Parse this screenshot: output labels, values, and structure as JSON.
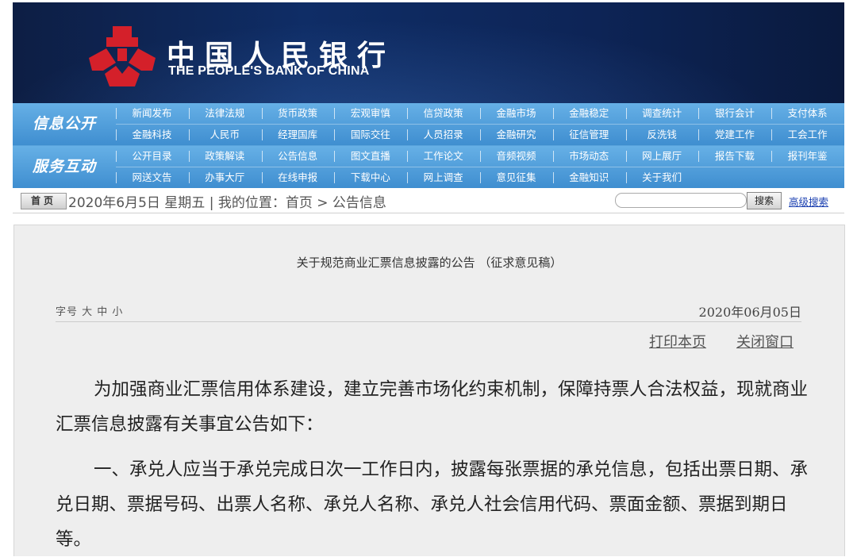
{
  "colors": {
    "banner_bg": "#0f2d66",
    "logo_red": "#d4202a",
    "nav_blue": "#4e9ad8",
    "link_blue": "#1a3fb0"
  },
  "header": {
    "logo_icon": "pboc-emblem-icon",
    "title_cn": "中国人民银行",
    "title_en": "THE PEOPLE'S BANK OF CHINA"
  },
  "nav": {
    "group1": {
      "label": "信息公开",
      "row1": [
        "新闻发布",
        "法律法规",
        "货币政策",
        "宏观审慎",
        "信贷政策",
        "金融市场",
        "金融稳定",
        "调查统计",
        "银行会计",
        "支付体系"
      ],
      "row2": [
        "金融科技",
        "人民币",
        "经理国库",
        "国际交往",
        "人员招录",
        "金融研究",
        "征信管理",
        "反洗钱",
        "党建工作",
        "工会工作"
      ]
    },
    "group2": {
      "label": "服务互动",
      "row1": [
        "公开目录",
        "政策解读",
        "公告信息",
        "图文直播",
        "工作论文",
        "音频视频",
        "市场动态",
        "网上展厅",
        "报告下载",
        "报刊年鉴"
      ],
      "row2": [
        "网送文告",
        "办事大厅",
        "在线申报",
        "下载中心",
        "网上调查",
        "意见征集",
        "金融知识",
        "关于我们"
      ]
    }
  },
  "breadcrumb": {
    "home_label": "首页",
    "text": "2020年6月5日 星期五 | 我的位置：首页 > 公告信息",
    "search_placeholder": "",
    "search_button": "搜索",
    "advanced_search": "高级搜索"
  },
  "article": {
    "title": "关于规范商业汇票信息披露的公告 （征求意见稿）",
    "font_size_label": "字号 大 中 小",
    "date": "2020年06月05日",
    "print_link": "打印本页",
    "close_link": "关闭窗口",
    "paragraphs": [
      "为加强商业汇票信用体系建设，建立完善市场化约束机制，保障持票人合法权益，现就商业汇票信息披露有关事宜公告如下：",
      "一、承兑人应当于承兑完成日次一工作日内，披露每张票据的承兑信息，包括出票日期、承兑日期、票据号码、出票人名称、承兑人名称、承兑人社会信用代码、票面金额、票据到期日等。"
    ]
  }
}
